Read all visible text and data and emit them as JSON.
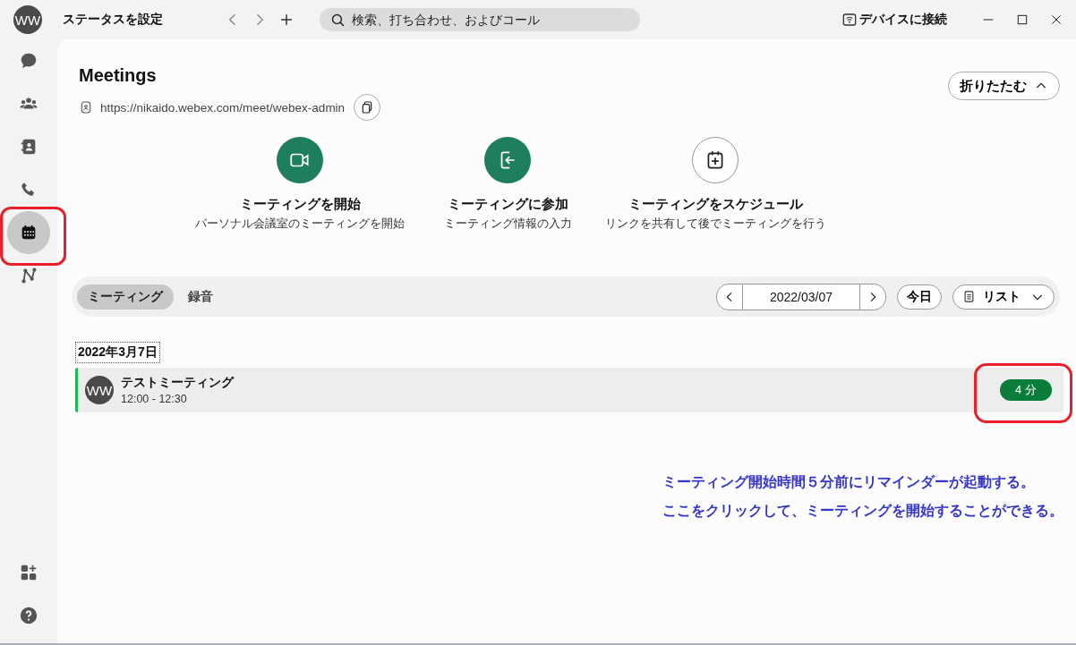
{
  "topbar": {
    "avatar_initials": "WW",
    "status": "ステータスを設定",
    "search": {
      "placeholder": "検索、打ち合わせ、およびコール"
    },
    "connect_device": "デバイスに接続"
  },
  "sidebar": {
    "items": [
      {
        "kind": "chat",
        "selected": false,
        "annotated": false
      },
      {
        "kind": "teams",
        "selected": false,
        "annotated": false
      },
      {
        "kind": "contacts",
        "selected": false,
        "annotated": false
      },
      {
        "kind": "calls",
        "selected": false,
        "annotated": false
      },
      {
        "kind": "meetings",
        "selected": true,
        "annotated": true
      },
      {
        "kind": "activity",
        "selected": false,
        "annotated": false
      }
    ],
    "bottom_items": [
      {
        "kind": "apps"
      },
      {
        "kind": "help"
      }
    ]
  },
  "meetings": {
    "title": "Meetings",
    "url": "https://nikaido.webex.com/meet/webex-admin",
    "collapse_button": "折りたたむ",
    "actions": [
      {
        "kind": "start",
        "title": "ミーティングを開始",
        "subtitle": "パーソナル会議室のミーティングを開始"
      },
      {
        "kind": "join",
        "title": "ミーティングに参加",
        "subtitle": "ミーティング情報の入力"
      },
      {
        "kind": "schedule",
        "title": "ミーティングをスケジュール",
        "subtitle": "リンクを共有して後でミーティングを行う"
      }
    ],
    "tabs": [
      {
        "label": "ミーティング",
        "selected": true
      },
      {
        "label": "録音",
        "selected": false
      }
    ],
    "date": "2022/03/07",
    "today_button": "今日",
    "view_menu": "リスト",
    "day_heading": "2022年3月7日",
    "items": [
      {
        "avatar_initials": "WW",
        "title": "テストミーティング",
        "time": "12:00 - 12:30",
        "reminder": "4 分",
        "annotated": true
      }
    ]
  },
  "note": {
    "lines": [
      "ミーティング開始時間５分前にリマインダーが起動する。",
      "ここをクリックして、ミーティングを開始することができる。"
    ]
  }
}
